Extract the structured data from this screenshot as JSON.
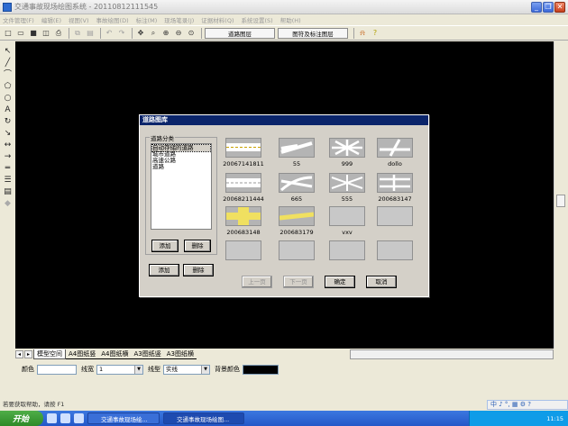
{
  "window": {
    "title": "交通事故现场绘图系统 - 20110812111545"
  },
  "menu": [
    "文件管理(F)",
    "编辑(E)",
    "视图(V)",
    "事故绘图(D)",
    "标注(M)",
    "现场笔录(J)",
    "证据材料(Q)",
    "系统设置(S)",
    "帮助(H)"
  ],
  "toolbar": {
    "road_layer": "道路图层",
    "symbol_layer": "图符及标注图层"
  },
  "dialog": {
    "title": "道路图库",
    "group_label": "道路分类",
    "categories": [
      "自动存储的道路",
      "城市道路",
      "高速公路",
      "道路"
    ],
    "selected_category": "自动存储的道路",
    "tiles": [
      {
        "caption": "20067141811",
        "has_image": true
      },
      {
        "caption": "55",
        "has_image": true
      },
      {
        "caption": "999",
        "has_image": true
      },
      {
        "caption": "dollo",
        "has_image": true
      },
      {
        "caption": "20068211444",
        "has_image": true
      },
      {
        "caption": "665",
        "has_image": true
      },
      {
        "caption": "555",
        "has_image": true
      },
      {
        "caption": "200683147",
        "has_image": true
      },
      {
        "caption": "200683148",
        "has_image": true
      },
      {
        "caption": "200683179",
        "has_image": true
      },
      {
        "caption": "vxv",
        "has_image": false
      },
      {
        "caption": "",
        "has_image": false
      },
      {
        "caption": "",
        "has_image": false
      },
      {
        "caption": "",
        "has_image": false
      },
      {
        "caption": "",
        "has_image": false
      },
      {
        "caption": "",
        "has_image": false
      }
    ],
    "add_cat": "添加",
    "del_cat": "删除",
    "add": "添加",
    "del": "删除",
    "prev": "上一页",
    "next": "下一页",
    "ok": "确定",
    "cancel": "取消"
  },
  "tabs": [
    "模型空间",
    "A4图纸竖",
    "A4图纸横",
    "A3图纸竖",
    "A3图纸横"
  ],
  "props": {
    "color_label": "颜色",
    "width_label": "线宽",
    "width_value": "1",
    "style_label": "线型",
    "style_value": "实线",
    "bg_label": "背景颜色"
  },
  "status": "若要获取帮助，请按 F1",
  "taskbar": {
    "start": "开始",
    "tasks": [
      "交通事故现场绘...",
      "交通事故现场绘图..."
    ],
    "time": "11:15"
  }
}
